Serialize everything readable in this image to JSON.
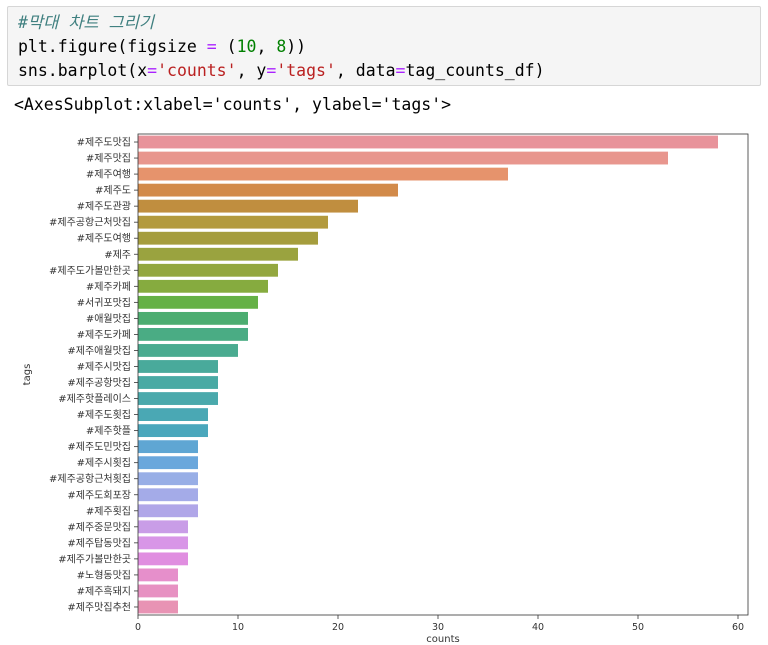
{
  "notebook": {
    "input_cell": {
      "comment": "#막대 차트 그리기",
      "line2": {
        "a": "plt.figure(figsize ",
        "eq": "=",
        "b": " (",
        "n1": "10",
        "c": ", ",
        "n2": "8",
        "d": "))"
      },
      "line3": {
        "a": "sns.barplot(x",
        "eq1": "=",
        "s1": "'counts'",
        "b": ", y",
        "eq2": "=",
        "s2": "'tags'",
        "c": ", data",
        "eq3": "=",
        "d": "tag_counts_df)"
      }
    },
    "output_text": "<AxesSubplot:xlabel='counts', ylabel='tags'>"
  },
  "chart_data": {
    "type": "bar",
    "orientation": "horizontal",
    "xlabel": "counts",
    "ylabel": "tags",
    "xlim": [
      0,
      61
    ],
    "xticks": [
      0,
      10,
      20,
      30,
      40,
      50,
      60
    ],
    "grid": false,
    "categories": [
      "#제주도맛집",
      "#제주맛집",
      "#제주여행",
      "#제주도",
      "#제주도관광",
      "#제주공항근처맛집",
      "#제주도여행",
      "#제주",
      "#제주도가볼만한곳",
      "#제주카페",
      "#서귀포맛집",
      "#애월맛집",
      "#제주도카페",
      "#제주애월맛집",
      "#제주시맛집",
      "#제주공항맛집",
      "#제주핫플레이스",
      "#제주도횟집",
      "#제주핫플",
      "#제주도민맛집",
      "#제주시횟집",
      "#제주공항근처횟집",
      "#제주도회포장",
      "#제주횟집",
      "#제주중문맛집",
      "#제주탑동맛집",
      "#제주가볼만한곳",
      "#노형동맛집",
      "#제주흑돼지",
      "#제주맛집추천"
    ],
    "values": [
      58,
      53,
      37,
      26,
      22,
      19,
      18,
      16,
      14,
      13,
      12,
      11,
      11,
      10,
      8,
      8,
      8,
      7,
      7,
      6,
      6,
      6,
      6,
      6,
      5,
      5,
      5,
      4,
      4,
      4
    ],
    "colors": [
      "#e8939b",
      "#e8968e",
      "#e6936c",
      "#d28a4a",
      "#c08e3f",
      "#b39a3e",
      "#a59d3d",
      "#9aa33f",
      "#93a73f",
      "#86ab3f",
      "#65b146",
      "#4cad71",
      "#4aac84",
      "#4aab90",
      "#49aa9b",
      "#49aaa4",
      "#4aa9ac",
      "#4aa8b4",
      "#4aa7bc",
      "#5fa6d3",
      "#6aa7dc",
      "#98aee6",
      "#a4abe8",
      "#b0a6e8",
      "#c99de7",
      "#d896e7",
      "#e08ee0",
      "#e68fcb",
      "#e791c2",
      "#e893b4"
    ]
  }
}
